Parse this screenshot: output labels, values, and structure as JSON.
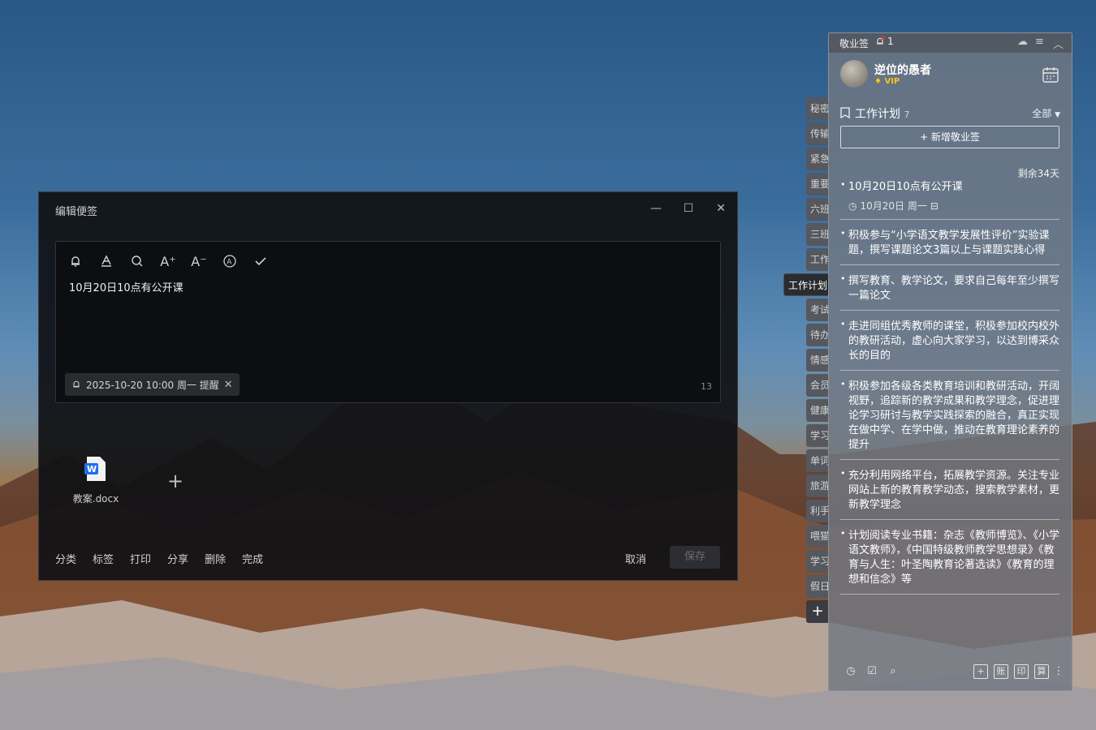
{
  "editor": {
    "title": "编辑便签",
    "note_text": "10月20日10点有公开课",
    "reminder": "2025-10-20 10:00 周一 提醒",
    "char_count": "13",
    "attachment": "教案.docx",
    "actions": [
      "分类",
      "标签",
      "打印",
      "分享",
      "删除",
      "完成"
    ],
    "cancel": "取消",
    "save": "保存"
  },
  "categories": [
    "秘密",
    "传输",
    "紧急",
    "重要",
    "六班",
    "三班",
    "工作",
    "工作计划",
    "考试",
    "待办",
    "情感",
    "会员",
    "健康",
    "学习",
    "单词",
    "旅游",
    "利手",
    "喂猫",
    "学习",
    "假日"
  ],
  "panel": {
    "app_name": "敬业签",
    "notif_count": "1",
    "username": "逆位的愚者",
    "vip": "VIP",
    "plan_title": "工作计划",
    "plan_count": "7",
    "filter": "全部",
    "new_note": "+ 新增敬业签",
    "remaining": "剩余34天",
    "notes": [
      {
        "text": "10月20日10点有公开课",
        "meta": "10月20日 周一"
      },
      {
        "text": "积极参与“小学语文教学发展性评价”实验课题，撰写课题论文3篇以上与课题实践心得"
      },
      {
        "text": "撰写教育、教学论文，要求自己每年至少撰写一篇论文"
      },
      {
        "text": "走进同组优秀教师的课堂，积极参加校内校外的教研活动，虚心向大家学习，以达到博采众长的目的"
      },
      {
        "text": "积极参加各级各类教育培训和教研活动，开阔视野，追踪新的教学成果和教学理念，促进理论学习研讨与教学实践探索的融合，真正实现在做中学、在学中做，推动在教育理论素养的提升"
      },
      {
        "text": "充分利用网络平台，拓展教学资源。关注专业网站上新的教育教学动态，搜索教学素材，更新教学理念"
      },
      {
        "text": "计划阅读专业书籍：杂志《教师博览》、《小学语文教师》，《中国特级教师教学思想录》《教育与人生：叶圣陶教育论著选读》《教育的理想和信念》等"
      }
    ],
    "footer_boxes": [
      "+",
      "账",
      "印",
      "算"
    ]
  }
}
